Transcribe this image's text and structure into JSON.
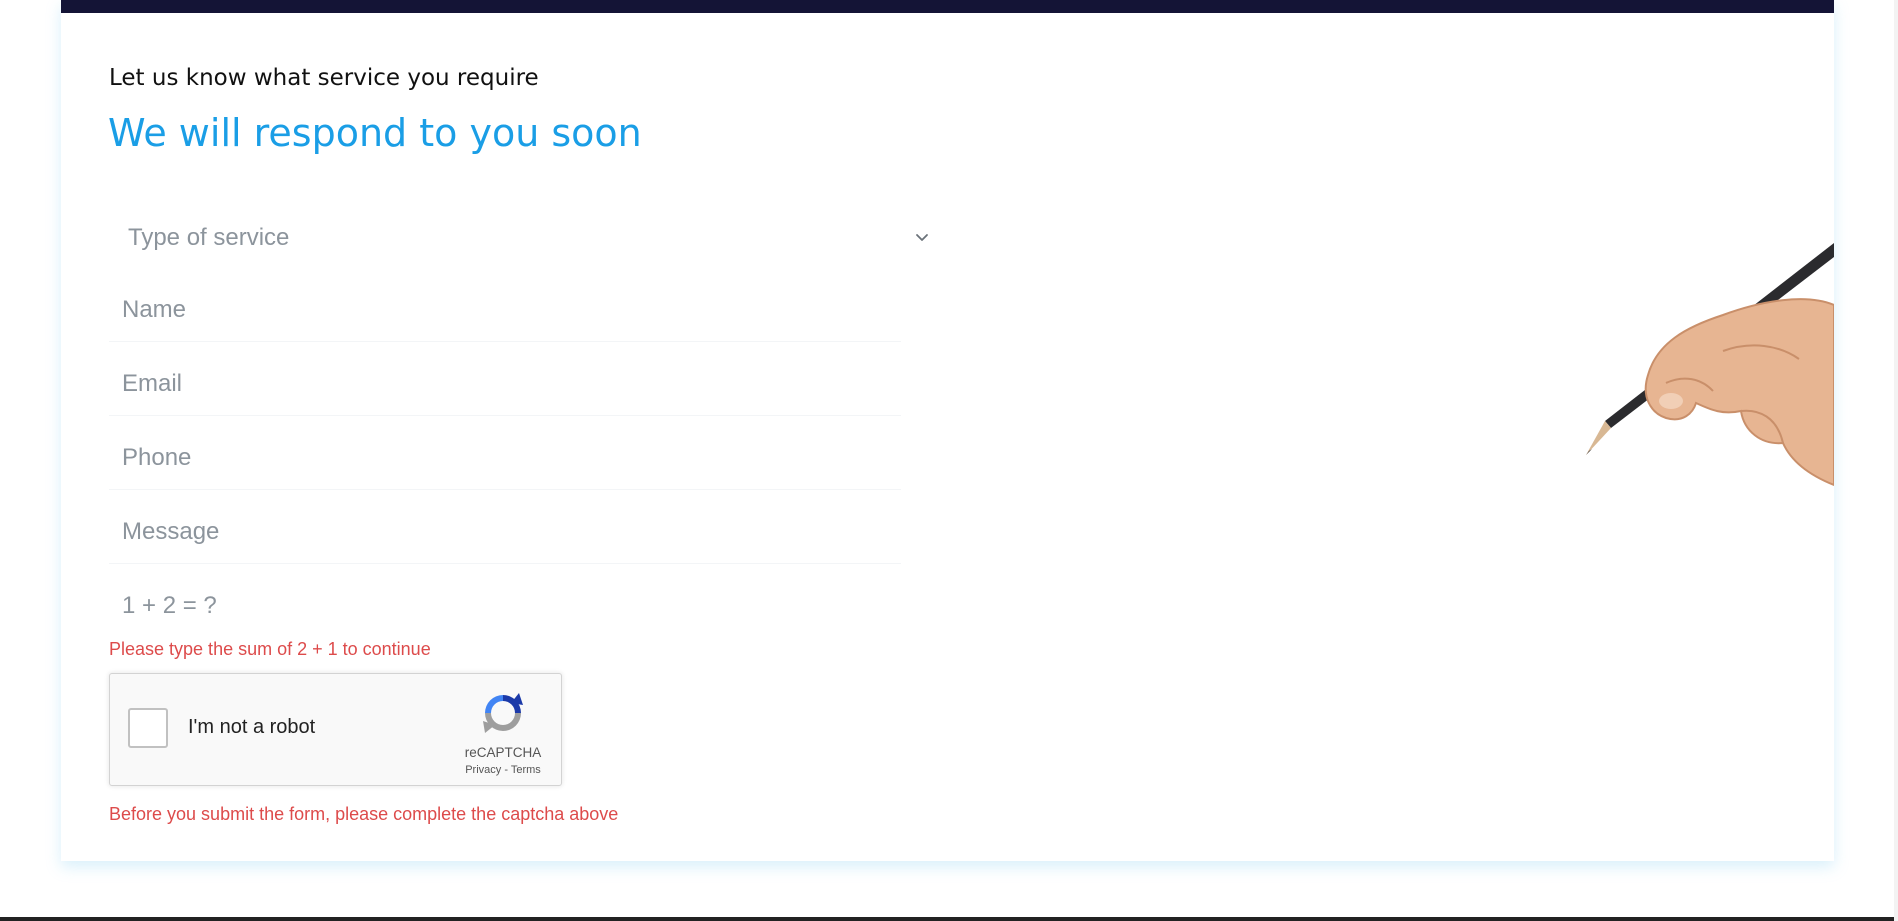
{
  "form": {
    "eyebrow": "Let us know what service you require",
    "headline": "We will respond to you soon",
    "service_select": {
      "placeholder": "Type of service"
    },
    "fields": {
      "name_placeholder": "Name",
      "email_placeholder": "Email",
      "phone_placeholder": "Phone",
      "message_placeholder": "Message",
      "math_placeholder": "1 + 2 = ?"
    },
    "math_error": "Please type the sum of 2 + 1 to continue",
    "captcha_error": "Before you submit the form, please complete the captcha above"
  },
  "recaptcha": {
    "label": "I'm not a robot",
    "brand": "reCAPTCHA",
    "privacy_link": "Privacy",
    "separator": "-",
    "terms_link": "Terms"
  },
  "illustration": {
    "icon": "hand-with-pencil"
  },
  "colors": {
    "accent": "#1a9ee6",
    "top_bar": "#141436",
    "error": "#dd4b4b",
    "placeholder": "#8c949c"
  }
}
